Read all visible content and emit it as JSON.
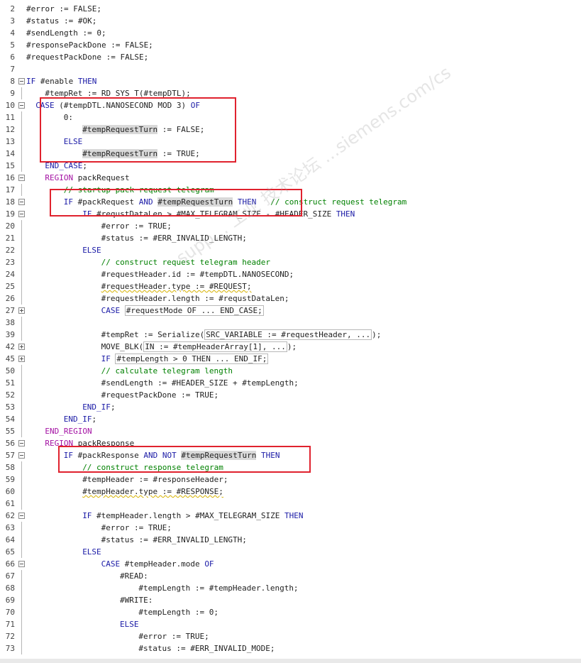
{
  "watermark": "supp… 工业 技术论坛 …siemens.com/cs",
  "lines": [
    {
      "n": "2",
      "fold": "",
      "indent": 0,
      "t": [
        [
          "#error := ",
          ""
        ],
        [
          "FALSE",
          ""
        ],
        [
          ";",
          ""
        ]
      ]
    },
    {
      "n": "3",
      "fold": "",
      "indent": 0,
      "t": [
        [
          "#status := #OK;",
          ""
        ]
      ]
    },
    {
      "n": "4",
      "fold": "",
      "indent": 0,
      "t": [
        [
          "#sendLength := 0;",
          ""
        ]
      ]
    },
    {
      "n": "5",
      "fold": "",
      "indent": 0,
      "t": [
        [
          "#responsePackDone := FALSE;",
          ""
        ]
      ]
    },
    {
      "n": "6",
      "fold": "",
      "indent": 0,
      "t": [
        [
          "#requestPackDone := FALSE;",
          ""
        ]
      ]
    },
    {
      "n": "7",
      "fold": "",
      "indent": 0,
      "t": []
    },
    {
      "n": "8",
      "fold": "minus",
      "indent": 0,
      "t": [
        [
          "IF",
          "kw"
        ],
        [
          " #enable ",
          ""
        ],
        [
          "THEN",
          "kw"
        ]
      ]
    },
    {
      "n": "9",
      "fold": "",
      "indent": 4,
      "t": [
        [
          "#tempRet := RD_SYS_T(#tempDTL);",
          ""
        ]
      ]
    },
    {
      "n": "10",
      "fold": "minus",
      "indent": 2,
      "t": [
        [
          "CASE",
          "kw"
        ],
        [
          " (#tempDTL.NANOSECOND MOD 3) ",
          ""
        ],
        [
          "OF",
          "kw"
        ]
      ]
    },
    {
      "n": "11",
      "fold": "",
      "indent": 8,
      "t": [
        [
          "0:",
          ""
        ]
      ]
    },
    {
      "n": "12",
      "fold": "",
      "indent": 12,
      "t": [
        [
          "#tempRequestTurn",
          "hl"
        ],
        [
          " := FALSE;",
          ""
        ]
      ]
    },
    {
      "n": "13",
      "fold": "",
      "indent": 8,
      "t": [
        [
          "ELSE",
          "kw"
        ]
      ]
    },
    {
      "n": "14",
      "fold": "",
      "indent": 12,
      "t": [
        [
          "#tempRequestTurn",
          "hl"
        ],
        [
          " := TRUE;",
          ""
        ]
      ]
    },
    {
      "n": "15",
      "fold": "",
      "indent": 4,
      "t": [
        [
          "END_CASE",
          "kw"
        ],
        [
          ";",
          ""
        ]
      ]
    },
    {
      "n": "16",
      "fold": "minus",
      "indent": 4,
      "t": [
        [
          "REGION",
          "kp"
        ],
        [
          " packRequest",
          ""
        ]
      ]
    },
    {
      "n": "17",
      "fold": "",
      "indent": 8,
      "t": [
        [
          "// startup pack request telegram",
          "cm"
        ]
      ]
    },
    {
      "n": "18",
      "fold": "minus",
      "indent": 8,
      "t": [
        [
          "IF",
          "kw"
        ],
        [
          " #packRequest ",
          ""
        ],
        [
          "AND",
          "kw"
        ],
        [
          " ",
          ""
        ],
        [
          "#tempRequestTurn",
          "hl"
        ],
        [
          " ",
          ""
        ],
        [
          "THEN",
          "kw"
        ],
        [
          "   ",
          ""
        ],
        [
          "// construct request telegram",
          "cm"
        ]
      ]
    },
    {
      "n": "19",
      "fold": "minus",
      "indent": 12,
      "t": [
        [
          "IF",
          "kw"
        ],
        [
          " #requstDataLen > #MAX_TELEGRAM_SIZE - #HEADER_SIZE ",
          ""
        ],
        [
          "THEN",
          "kw"
        ]
      ]
    },
    {
      "n": "20",
      "fold": "",
      "indent": 16,
      "t": [
        [
          "#error := TRUE;",
          ""
        ]
      ]
    },
    {
      "n": "21",
      "fold": "",
      "indent": 16,
      "t": [
        [
          "#status := #ERR_INVALID_LENGTH;",
          ""
        ]
      ]
    },
    {
      "n": "22",
      "fold": "",
      "indent": 12,
      "t": [
        [
          "ELSE",
          "kw"
        ]
      ]
    },
    {
      "n": "23",
      "fold": "",
      "indent": 16,
      "t": [
        [
          "// construct request telegram header",
          "cm"
        ]
      ]
    },
    {
      "n": "24",
      "fold": "",
      "indent": 16,
      "t": [
        [
          "#requestHeader.id := #tempDTL.NANOSECOND;",
          ""
        ]
      ]
    },
    {
      "n": "25",
      "fold": "",
      "indent": 16,
      "t": [
        [
          "#requestHeader.type := #REQUEST;",
          "squig"
        ]
      ]
    },
    {
      "n": "26",
      "fold": "",
      "indent": 16,
      "t": [
        [
          "#requestHeader.length := #requstDataLen;",
          ""
        ]
      ]
    },
    {
      "n": "27",
      "fold": "plus",
      "indent": 16,
      "t": [
        [
          "CASE",
          "kw"
        ],
        [
          " ",
          ""
        ],
        [
          "#requestMode OF ... END_CASE;",
          "box"
        ]
      ]
    },
    {
      "n": "38",
      "fold": "",
      "indent": 0,
      "t": []
    },
    {
      "n": "39",
      "fold": "",
      "indent": 16,
      "t": [
        [
          "#tempRet := Serialize(",
          ""
        ],
        [
          "SRC_VARIABLE := #requestHeader, ...",
          "box"
        ],
        [
          ");",
          ""
        ]
      ]
    },
    {
      "n": "42",
      "fold": "plus",
      "indent": 16,
      "t": [
        [
          "MOVE_BLK(",
          ""
        ],
        [
          "IN := #tempHeaderArray[1], ...",
          "box"
        ],
        [
          ");",
          ""
        ]
      ]
    },
    {
      "n": "45",
      "fold": "plus",
      "indent": 16,
      "t": [
        [
          "IF",
          "kw"
        ],
        [
          " ",
          ""
        ],
        [
          "#tempLength > 0 THEN ... END_IF;",
          "box"
        ]
      ]
    },
    {
      "n": "50",
      "fold": "",
      "indent": 16,
      "t": [
        [
          "// calculate telegram length",
          "cm"
        ]
      ]
    },
    {
      "n": "51",
      "fold": "",
      "indent": 16,
      "t": [
        [
          "#sendLength := #HEADER_SIZE + #tempLength;",
          ""
        ]
      ]
    },
    {
      "n": "52",
      "fold": "",
      "indent": 16,
      "t": [
        [
          "#requestPackDone := TRUE;",
          ""
        ]
      ]
    },
    {
      "n": "53",
      "fold": "",
      "indent": 12,
      "t": [
        [
          "END_IF",
          "kw"
        ],
        [
          ";",
          ""
        ]
      ]
    },
    {
      "n": "54",
      "fold": "",
      "indent": 8,
      "t": [
        [
          "END_IF",
          "kw"
        ],
        [
          ";",
          ""
        ]
      ]
    },
    {
      "n": "55",
      "fold": "",
      "indent": 4,
      "t": [
        [
          "END_REGION",
          "kp"
        ]
      ]
    },
    {
      "n": "56",
      "fold": "minus",
      "indent": 4,
      "t": [
        [
          "REGION",
          "kp"
        ],
        [
          " packResponse",
          ""
        ]
      ]
    },
    {
      "n": "57",
      "fold": "minus",
      "indent": 8,
      "t": [
        [
          "IF",
          "kw"
        ],
        [
          " #packResponse ",
          ""
        ],
        [
          "AND NOT",
          "kw"
        ],
        [
          " ",
          ""
        ],
        [
          "#tempRequestTurn",
          "hl"
        ],
        [
          " ",
          ""
        ],
        [
          "THEN",
          "kw"
        ]
      ]
    },
    {
      "n": "58",
      "fold": "",
      "indent": 12,
      "t": [
        [
          "// construct response telegram",
          "cm"
        ]
      ]
    },
    {
      "n": "59",
      "fold": "",
      "indent": 12,
      "t": [
        [
          "#tempHeader := #responseHeader;",
          ""
        ]
      ]
    },
    {
      "n": "60",
      "fold": "",
      "indent": 12,
      "t": [
        [
          "#tempHeader.type := #RESPONSE;",
          "squig"
        ]
      ]
    },
    {
      "n": "61",
      "fold": "",
      "indent": 0,
      "t": []
    },
    {
      "n": "62",
      "fold": "minus",
      "indent": 12,
      "t": [
        [
          "IF",
          "kw"
        ],
        [
          " #tempHeader.length > #MAX_TELEGRAM_SIZE ",
          ""
        ],
        [
          "THEN",
          "kw"
        ]
      ]
    },
    {
      "n": "63",
      "fold": "",
      "indent": 16,
      "t": [
        [
          "#error := TRUE;",
          ""
        ]
      ]
    },
    {
      "n": "64",
      "fold": "",
      "indent": 16,
      "t": [
        [
          "#status := #ERR_INVALID_LENGTH;",
          ""
        ]
      ]
    },
    {
      "n": "65",
      "fold": "",
      "indent": 12,
      "t": [
        [
          "ELSE",
          "kw"
        ]
      ]
    },
    {
      "n": "66",
      "fold": "minus",
      "indent": 16,
      "t": [
        [
          "CASE",
          "kw"
        ],
        [
          " #tempHeader.mode ",
          ""
        ],
        [
          "OF",
          "kw"
        ]
      ]
    },
    {
      "n": "67",
      "fold": "",
      "indent": 20,
      "t": [
        [
          "#READ:",
          ""
        ]
      ]
    },
    {
      "n": "68",
      "fold": "",
      "indent": 24,
      "t": [
        [
          "#tempLength := #tempHeader.length;",
          ""
        ]
      ]
    },
    {
      "n": "69",
      "fold": "",
      "indent": 20,
      "t": [
        [
          "#WRITE:",
          ""
        ]
      ]
    },
    {
      "n": "70",
      "fold": "",
      "indent": 24,
      "t": [
        [
          "#tempLength := 0;",
          ""
        ]
      ]
    },
    {
      "n": "71",
      "fold": "",
      "indent": 20,
      "t": [
        [
          "ELSE",
          "kw"
        ]
      ]
    },
    {
      "n": "72",
      "fold": "",
      "indent": 24,
      "t": [
        [
          "#error := TRUE;",
          ""
        ]
      ]
    },
    {
      "n": "73",
      "fold": "",
      "indent": 24,
      "t": [
        [
          "#status := #ERR_INVALID_MODE;",
          ""
        ]
      ]
    }
  ]
}
